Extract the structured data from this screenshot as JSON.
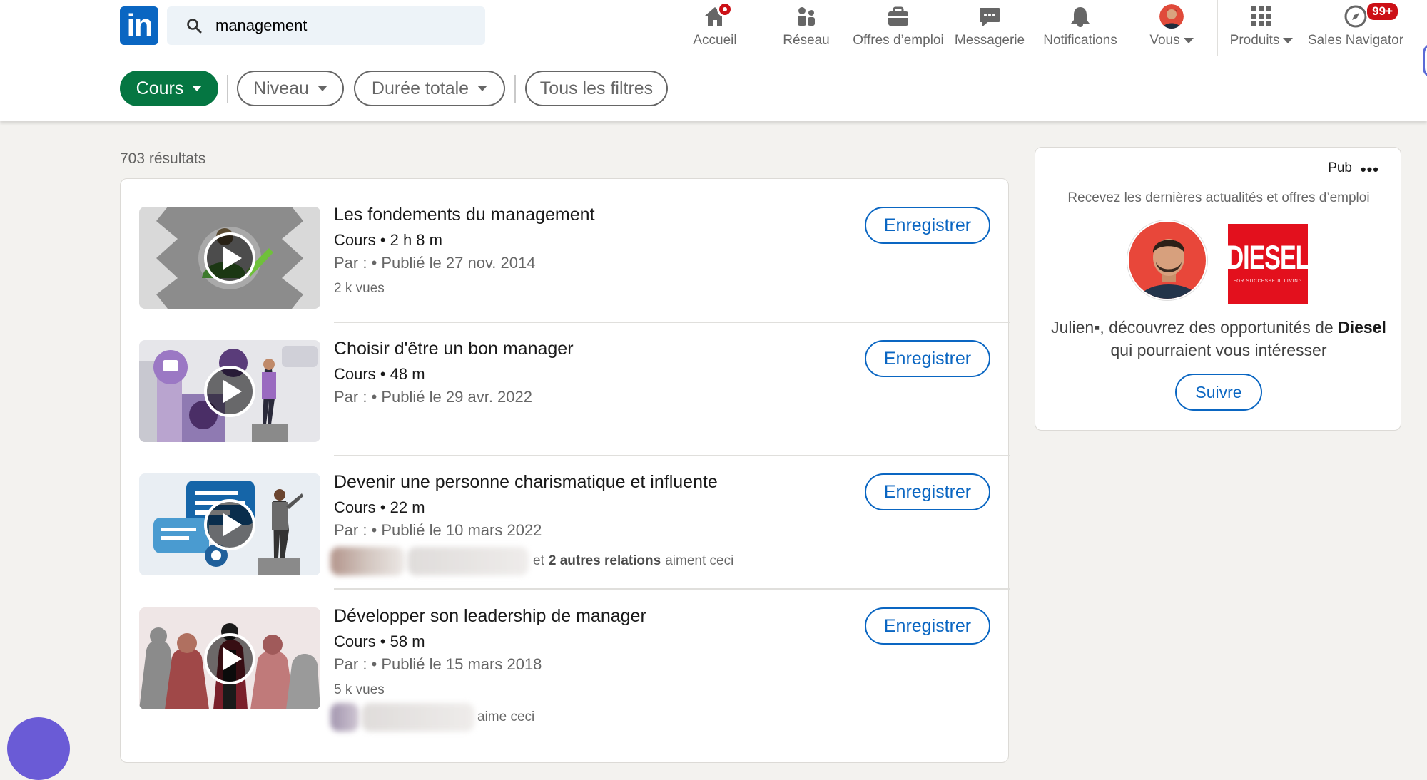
{
  "search": {
    "value": "management"
  },
  "nav": {
    "items": [
      {
        "label": "Accueil"
      },
      {
        "label": "Réseau"
      },
      {
        "label": "Offres d’emploi"
      },
      {
        "label": "Messagerie"
      },
      {
        "label": "Notifications"
      },
      {
        "label": "Vous"
      },
      {
        "label": "Produits"
      },
      {
        "label": "Sales Navigator",
        "badge": "99+"
      }
    ]
  },
  "filters": {
    "active": "Cours",
    "niveau": "Niveau",
    "duree": "Durée totale",
    "all": "Tous les filtres"
  },
  "results": {
    "count": "703 résultats",
    "save_label": "Enregistrer",
    "items": [
      {
        "title": "Les fondements du management",
        "meta": "Cours • 2 h 8 m",
        "published": "Par : • Publié le 27 nov. 2014",
        "views": "2 k vues"
      },
      {
        "title": "Choisir d'être un bon manager",
        "meta": "Cours • 48 m",
        "published": "Par : • Publié le 29 avr. 2022"
      },
      {
        "title": "Devenir une personne charismatique et influente",
        "meta": "Cours • 22 m",
        "published": "Par : • Publié le 10 mars 2022",
        "social_prefix": "et",
        "social_bold": "2 autres relations",
        "social_suffix": "aiment ceci"
      },
      {
        "title": "Développer son leadership de manager",
        "meta": "Cours • 58 m",
        "published": "Par : • Publié le 15 mars 2018",
        "views": "5 k vues",
        "social_suffix": "aime ceci"
      }
    ]
  },
  "ad": {
    "label": "Pub",
    "tagline": "Recevez les dernières actualités et offres d’emploi",
    "brand": "DIESEL",
    "brand_sub": "FOR SUCCESSFUL LIVING",
    "text_pre": "Julien▪, découvrez des opportunités de",
    "text_bold": "Diesel",
    "text_post": "qui pourraient vous intéresser",
    "follow": "Suivre"
  }
}
